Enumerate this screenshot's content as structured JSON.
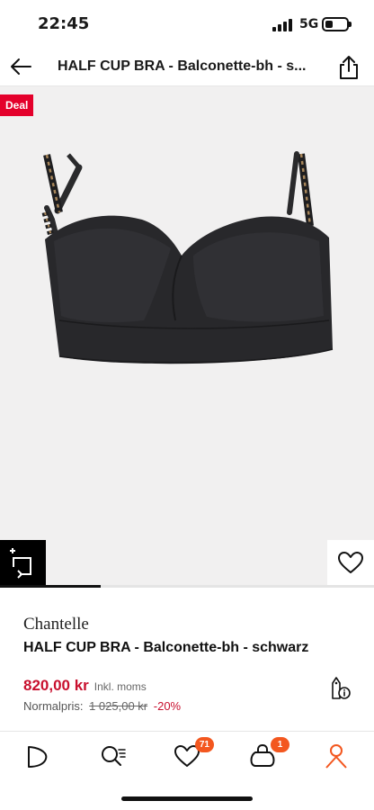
{
  "status_bar": {
    "time": "22:45",
    "network": "5G",
    "battery_level": 0.35
  },
  "header": {
    "title": "HALF CUP BRA - Balconette-bh - s...",
    "back_icon": "arrow-left-icon",
    "share_icon": "share-icon"
  },
  "product": {
    "deal_badge": "Deal",
    "brand": "Chantelle",
    "name": "HALF CUP BRA - Balconette-bh - schwarz",
    "price": "820,00 kr",
    "tax_note": "Inkl. moms",
    "normal_price_label": "Normalpris:",
    "normal_price": "1 025,00 kr",
    "discount": "-20%",
    "image_progress": 0.27
  },
  "tab_bar": {
    "items": [
      {
        "name": "home",
        "icon": "home-icon"
      },
      {
        "name": "search",
        "icon": "search-icon"
      },
      {
        "name": "wishlist",
        "icon": "heart-icon",
        "badge": "71"
      },
      {
        "name": "cart",
        "icon": "bag-icon",
        "badge": "1"
      },
      {
        "name": "account",
        "icon": "user-icon"
      }
    ]
  },
  "colors": {
    "accent": "#f3571f",
    "sale": "#c8102e",
    "deal": "#e4002b"
  }
}
